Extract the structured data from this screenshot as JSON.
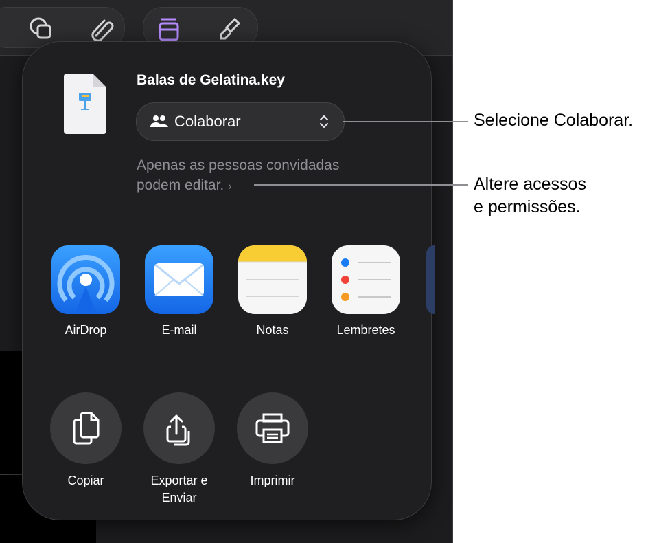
{
  "document": {
    "title": "Balas de Gelatina.key"
  },
  "collaborate": {
    "label": "Colaborar",
    "access": "Apenas as pessoas convidadas podem editar.",
    "access_chevron": "›"
  },
  "apps": [
    {
      "label": "AirDrop"
    },
    {
      "label": "E-mail"
    },
    {
      "label": "Notas"
    },
    {
      "label": "Lembretes"
    }
  ],
  "actions": [
    {
      "label": "Copiar"
    },
    {
      "label": "Exportar e Enviar"
    },
    {
      "label": "Imprimir"
    }
  ],
  "callouts": {
    "collaborate": "Selecione Colaborar.",
    "access_line1": "Altere acessos",
    "access_line2": "e permissões."
  },
  "colors": {
    "accent_purple": "#b68cff",
    "airdrop_blue": "#1a7cf5",
    "notes_yellow": "#f7cd33"
  }
}
